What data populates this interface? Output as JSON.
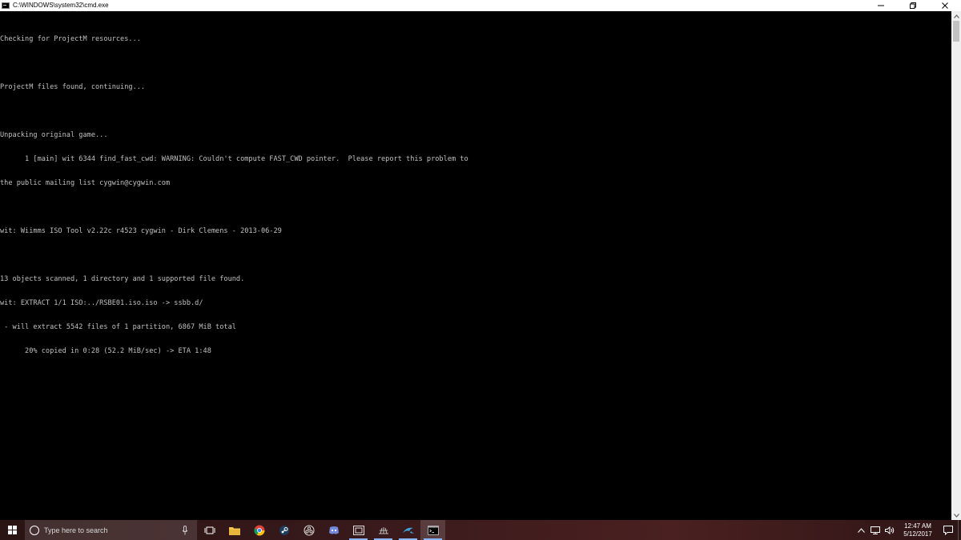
{
  "window": {
    "title": "C:\\WINDOWS\\system32\\cmd.exe",
    "controls": [
      "minimize",
      "restore",
      "close"
    ]
  },
  "console": {
    "text_color": "#c0c0c0",
    "background": "#000000",
    "lines": [
      "Checking for ProjectM resources...",
      "",
      "ProjectM files found, continuing...",
      "",
      "Unpacking original game...",
      "      1 [main] wit 6344 find_fast_cwd: WARNING: Couldn't compute FAST_CWD pointer.  Please report this problem to",
      "the public mailing list cygwin@cygwin.com",
      "",
      "wit: Wiimms ISO Tool v2.22c r4523 cygwin - Dirk Clemens - 2013-06-29",
      "",
      "13 objects scanned, 1 directory and 1 supported file found.",
      "wit: EXTRACT 1/1 ISO:../RSBE01.iso.iso -> ssbb.d/",
      " - will extract 5542 files of 1 partition, 6867 MiB total",
      "      20% copied in 0:28 (52.2 MiB/sec) -> ETA 1:48"
    ]
  },
  "taskbar": {
    "search_placeholder": "Type here to search",
    "apps": [
      {
        "name": "task-view-icon",
        "active": false
      },
      {
        "name": "file-explorer-icon",
        "active": false
      },
      {
        "name": "chrome-icon",
        "active": false
      },
      {
        "name": "steam-icon",
        "active": false
      },
      {
        "name": "obs-icon",
        "active": false
      },
      {
        "name": "discord-icon",
        "active": false
      },
      {
        "name": "capture-app-icon",
        "active": false
      },
      {
        "name": "network-app-icon",
        "active": false
      },
      {
        "name": "dolphin-icon",
        "active": false
      },
      {
        "name": "cmd-icon",
        "active": true
      }
    ],
    "clock": {
      "time": "12:47 AM",
      "date": "5/12/2017"
    }
  }
}
